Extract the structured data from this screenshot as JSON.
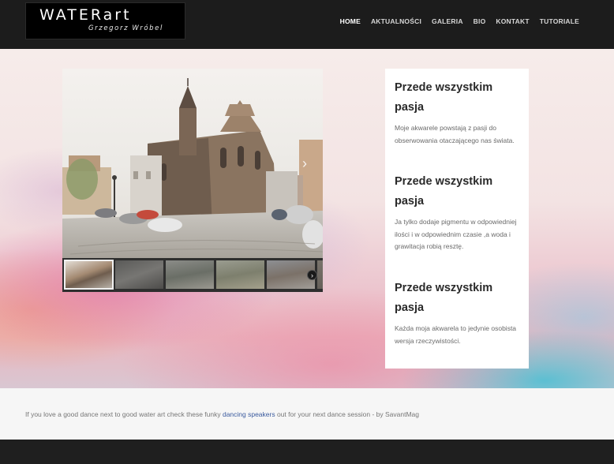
{
  "logo": {
    "title": "WATERart",
    "subtitle": "Grzegorz Wróbel"
  },
  "nav": [
    {
      "label": "HOME",
      "active": true
    },
    {
      "label": "AKTUALNOŚCI",
      "active": false
    },
    {
      "label": "GALERIA",
      "active": false
    },
    {
      "label": "BIO",
      "active": false
    },
    {
      "label": "KONTAKT",
      "active": false
    },
    {
      "label": "TUTORIALE",
      "active": false
    }
  ],
  "slider": {
    "next_icon": "chevron-right-icon",
    "thumb_count": 6,
    "active_thumb": 1
  },
  "features": [
    {
      "title": "Przede wszystkim pasja",
      "text": "Moje akwarele powstają z pasji do obserwowania otaczającego nas świata."
    },
    {
      "title": "Przede wszystkim pasja",
      "text": "Ja tylko dodaje pigmentu w odpowiedniej ilości i w odpowiednim czasie ,a woda i grawitacja robią resztę."
    },
    {
      "title": "Przede wszystkim pasja",
      "text": "Każda moja akwarela to jedynie osobista wersja rzeczywistości."
    }
  ],
  "footer": {
    "text_before": "If you love a good dance next to good water art check these funky ",
    "link_label": "dancing speakers",
    "text_after": " out for your next dance session - by SavantMag"
  }
}
